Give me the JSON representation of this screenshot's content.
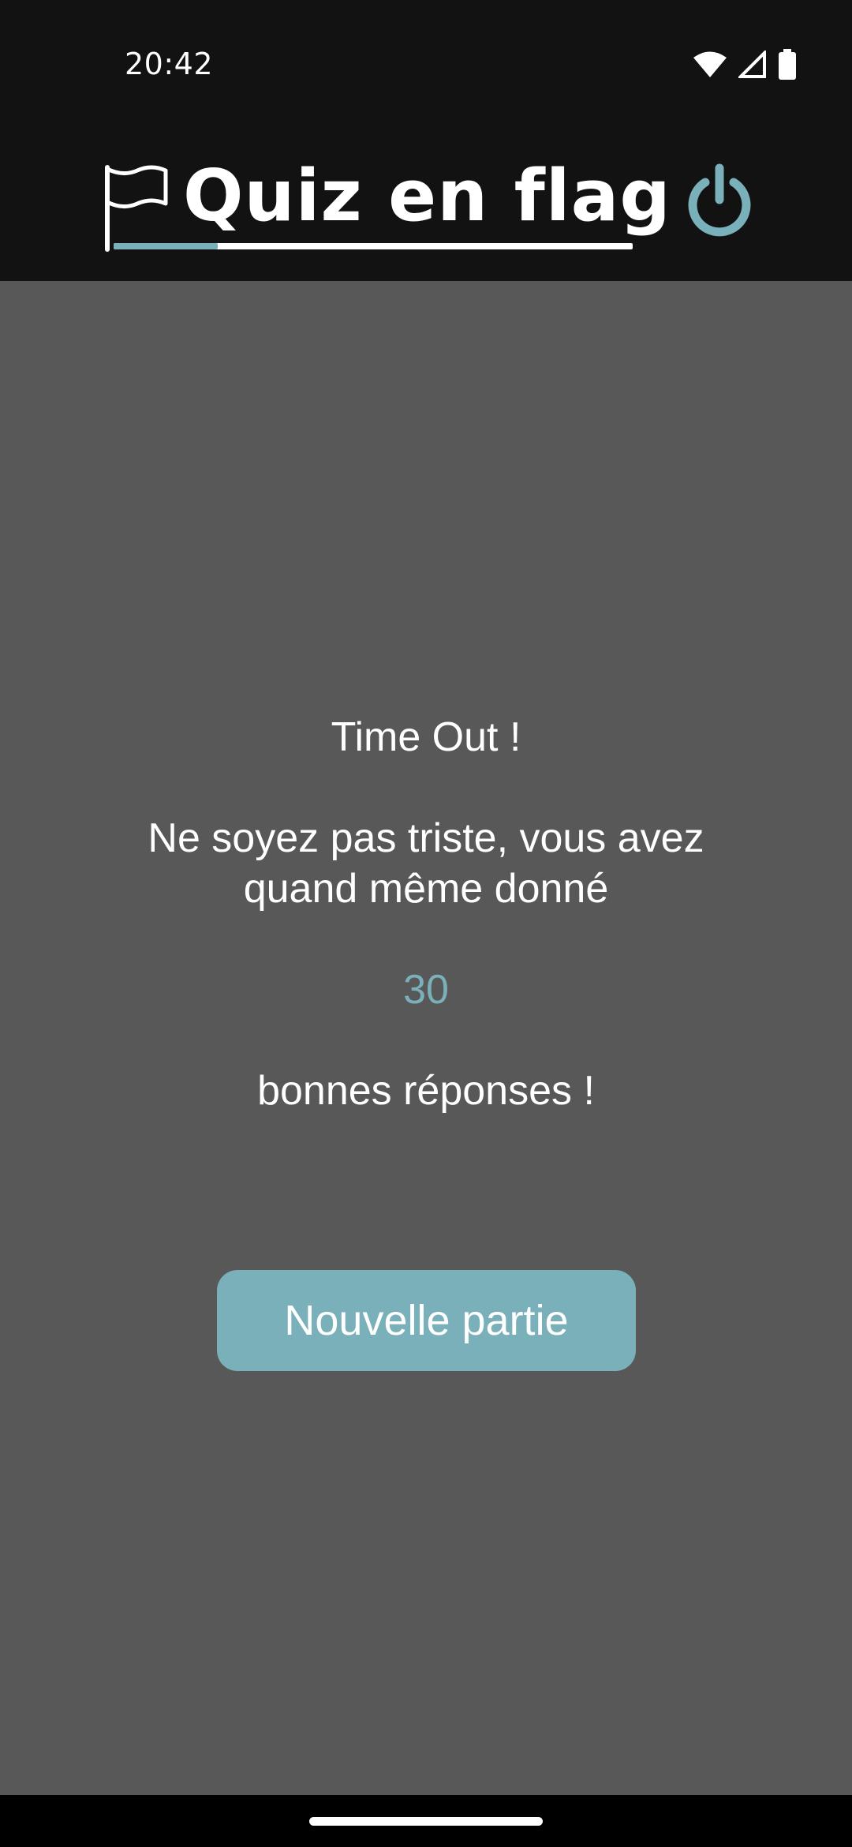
{
  "status_bar": {
    "time": "20:42",
    "icons": [
      "wifi-icon",
      "cell-signal-icon",
      "battery-icon"
    ]
  },
  "header": {
    "logo_text": "Quiz en flag",
    "logo_icon": "flag-icon",
    "power_icon": "power-icon"
  },
  "result": {
    "title": "Time Out !",
    "message_line1": "Ne soyez pas triste, vous avez",
    "message_line2": "quand même donné",
    "score": "30",
    "suffix": "bonnes réponses !"
  },
  "actions": {
    "new_game_label": "Nouvelle partie"
  },
  "colors": {
    "accent": "#7ab0ba",
    "background": "#585858",
    "header_background": "#121212",
    "text": "#ffffff"
  }
}
